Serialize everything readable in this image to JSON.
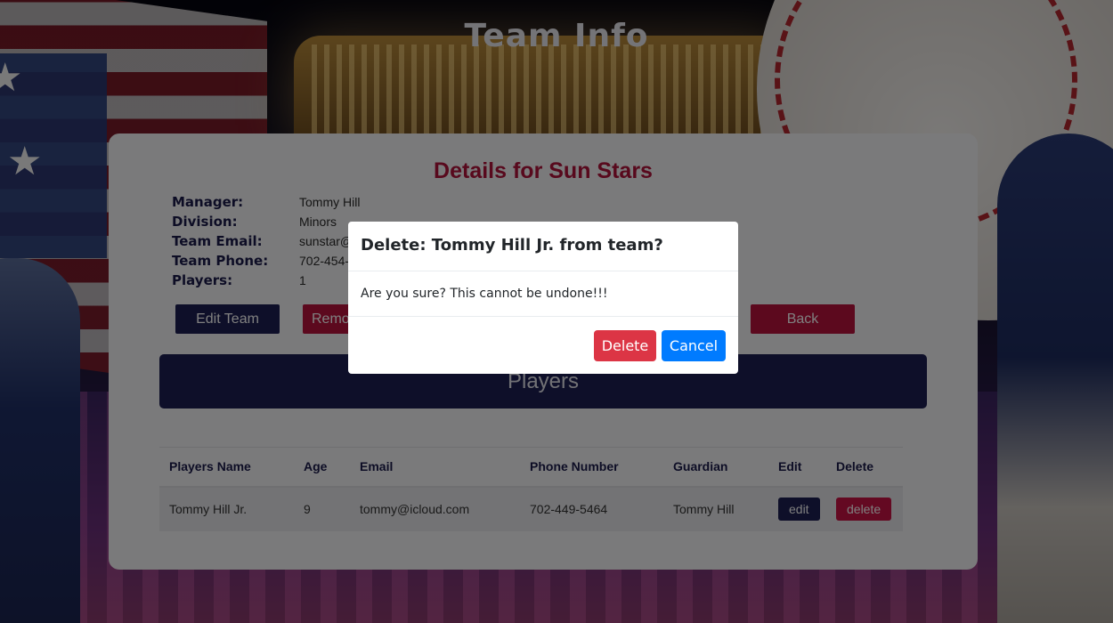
{
  "page": {
    "title": "Team Info"
  },
  "team": {
    "details_title": "Details for Sun Stars",
    "fields": [
      {
        "label": "Manager:",
        "value": "Tommy Hill"
      },
      {
        "label": "Division:",
        "value": "Minors"
      },
      {
        "label": "Team Email:",
        "value": "sunstar@"
      },
      {
        "label": "Team Phone:",
        "value": "702-454-"
      },
      {
        "label": "Players:",
        "value": "1"
      }
    ]
  },
  "actions": {
    "edit_team": "Edit Team",
    "remove": "Remove",
    "back": "Back"
  },
  "players": {
    "banner": "Players",
    "columns": [
      "Players Name",
      "Age",
      "Email",
      "Phone Number",
      "Guardian",
      "Edit",
      "Delete"
    ],
    "rows": [
      {
        "name": "Tommy Hill Jr.",
        "age": "9",
        "email": "tommy@icloud.com",
        "phone": "702-449-5464",
        "guardian": "Tommy Hill",
        "edit_label": "edit",
        "delete_label": "delete"
      }
    ]
  },
  "modal": {
    "title": "Delete: Tommy Hill Jr. from team?",
    "body": "Are you sure? This cannot be undone!!!",
    "delete_label": "Delete",
    "cancel_label": "Cancel"
  },
  "colors": {
    "navy": "#1c1e52",
    "crimson": "#b8123d",
    "title_red": "#b0123a",
    "danger": "#dc3545",
    "primary": "#007bff"
  }
}
